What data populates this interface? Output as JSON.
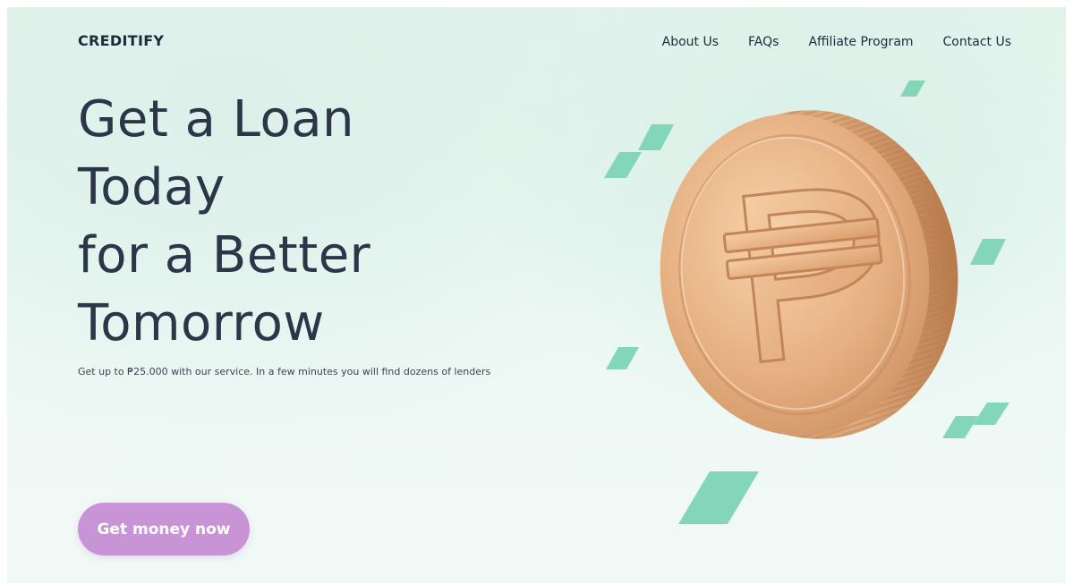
{
  "brand": {
    "logo_text": "CREDITIFY"
  },
  "nav": {
    "items": [
      "About Us",
      "FAQs",
      "Affiliate Program",
      "Contact Us"
    ]
  },
  "hero": {
    "headline_lines": [
      "Get a Loan",
      "Today",
      "for a Better",
      "Tomorrow"
    ],
    "subtext": "Get up to ₱25.000 with our service. In a few minutes you will find dozens of lenders",
    "cta_label": "Get money now"
  },
  "illustration": {
    "coin_symbol": "peso-sign-icon",
    "coin_color": "#e2ad7c",
    "accent_shapes_color": "#7fd4b8"
  },
  "colors": {
    "text_dark": "#2c3648",
    "cta_background": "#c994d6",
    "background": "#e4f4ee"
  }
}
